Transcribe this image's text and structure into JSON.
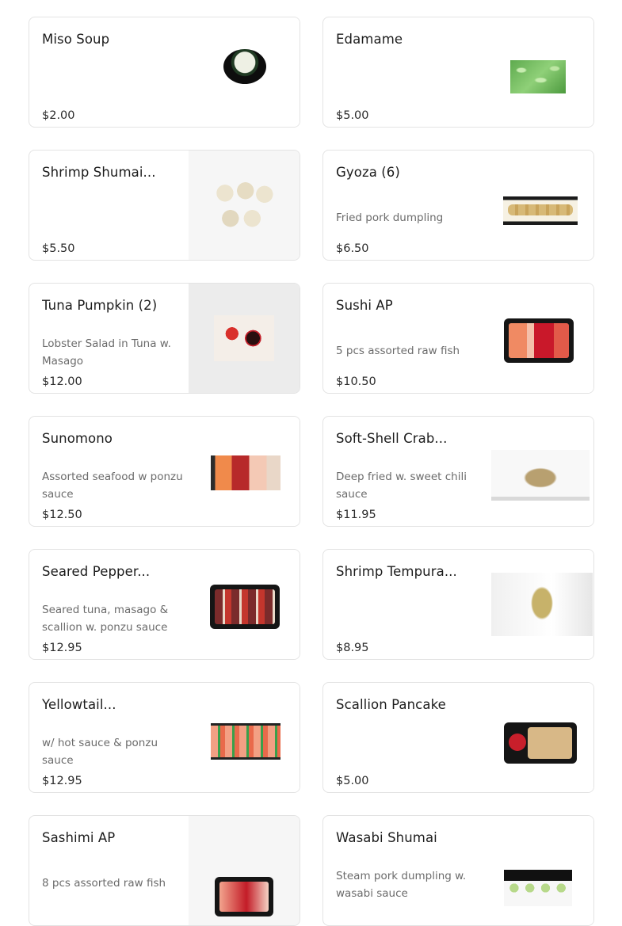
{
  "menu": {
    "items": [
      {
        "name": "Miso Soup",
        "description": "",
        "price": "$2.00",
        "image": "miso-soup-image"
      },
      {
        "name": "Edamame",
        "description": "",
        "price": "$5.00",
        "image": "edamame-image"
      },
      {
        "name": "Shrimp Shumai...",
        "description": "",
        "price": "$5.50",
        "image": "shrimp-shumai-image"
      },
      {
        "name": "Gyoza (6)",
        "description": "Fried pork dumpling",
        "price": "$6.50",
        "image": "gyoza-image"
      },
      {
        "name": "Tuna Pumpkin (2)",
        "description": "Lobster Salad in Tuna w. Masago",
        "price": "$12.00",
        "image": "tuna-pumpkin-image"
      },
      {
        "name": "Sushi AP",
        "description": "5 pcs assorted raw fish",
        "price": "$10.50",
        "image": "sushi-ap-image"
      },
      {
        "name": "Sunomono",
        "description": "Assorted seafood w ponzu sauce",
        "price": "$12.50",
        "image": "sunomono-image"
      },
      {
        "name": "Soft-Shell Crab...",
        "description": "Deep fried w. sweet chili sauce",
        "price": "$11.95",
        "image": "soft-shell-crab-image"
      },
      {
        "name": "Seared Pepper...",
        "description": "Seared tuna, masago & scallion w. ponzu sauce",
        "price": "$12.95",
        "image": "seared-pepper-image"
      },
      {
        "name": "Shrimp Tempura...",
        "description": "",
        "price": "$8.95",
        "image": "shrimp-tempura-image"
      },
      {
        "name": "Yellowtail...",
        "description": "w/ hot sauce & ponzu sauce",
        "price": "$12.95",
        "image": "yellowtail-image"
      },
      {
        "name": "Scallion Pancake",
        "description": "",
        "price": "$5.00",
        "image": "scallion-pancake-image"
      },
      {
        "name": "Sashimi AP",
        "description": "8 pcs assorted raw fish",
        "price": "",
        "image": "sashimi-ap-image"
      },
      {
        "name": "Wasabi Shumai",
        "description": "Steam pork dumpling w. wasabi sauce",
        "price": "",
        "image": "wasabi-shumai-image"
      }
    ]
  }
}
